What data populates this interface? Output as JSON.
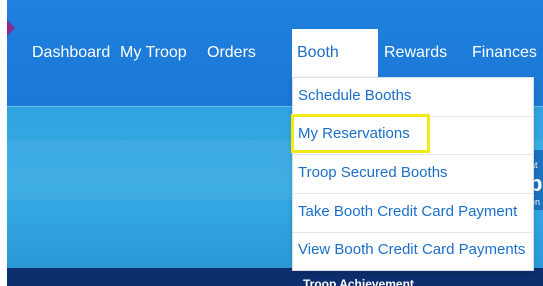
{
  "nav": {
    "items": [
      {
        "label": "Dashboard"
      },
      {
        "label": "My Troop"
      },
      {
        "label": "Orders"
      },
      {
        "label": "Booth"
      },
      {
        "label": "Rewards"
      },
      {
        "label": "Finances"
      }
    ],
    "active": "Booth"
  },
  "dropdown": {
    "items": [
      {
        "label": "Schedule Booths"
      },
      {
        "label": "My Reservations"
      },
      {
        "label": "Troop Secured Booths"
      },
      {
        "label": "Take Booth Credit Card Payment"
      },
      {
        "label": "View Booth Credit Card Payments"
      }
    ],
    "highlighted": "My Reservations"
  },
  "hero": {
    "right_text_1": "at",
    "right_text_2": "p",
    "right_text_3": "en"
  },
  "bottom": {
    "text": "Troop Achievement"
  },
  "colors": {
    "nav_bg": "#1f80dd",
    "hero_bg": "#31a3e0",
    "link": "#1b6fc8",
    "highlight": "#f2ea18",
    "bottom_bar": "#0d2f6e"
  }
}
